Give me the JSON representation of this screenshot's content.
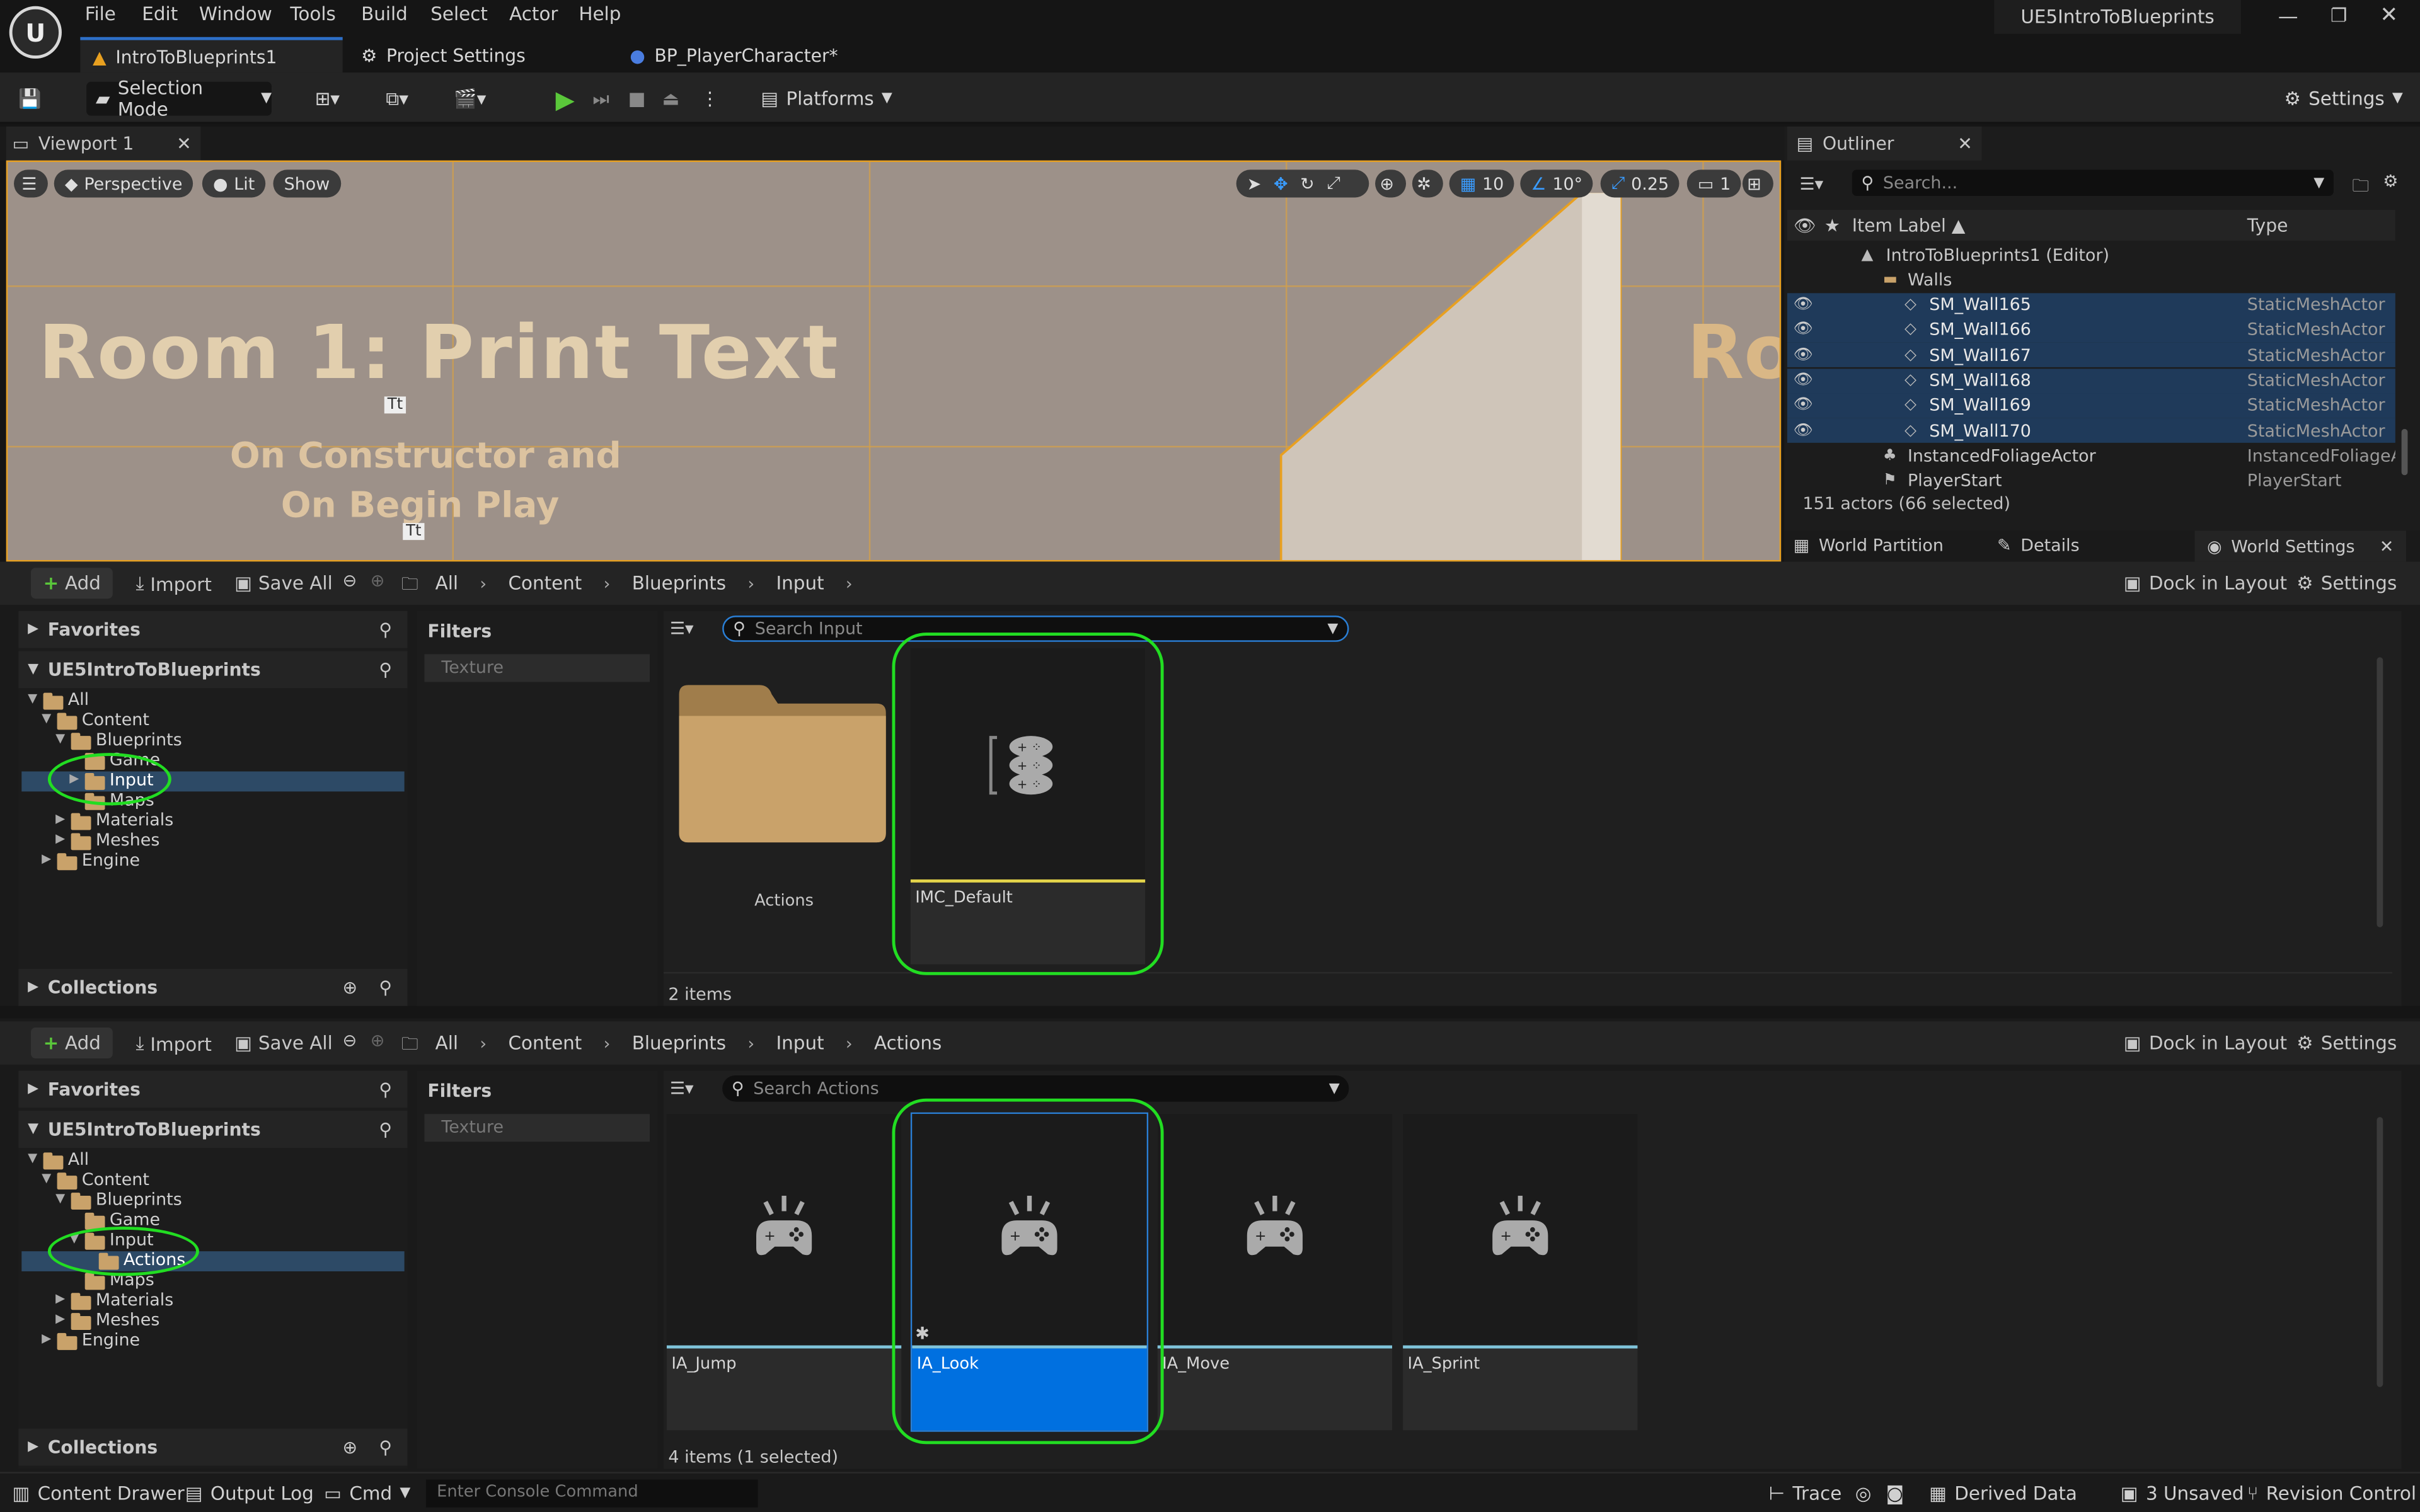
{
  "menu": [
    "File",
    "Edit",
    "Window",
    "Tools",
    "Build",
    "Select",
    "Actor",
    "Help"
  ],
  "project_name": "UE5IntroToBlueprints",
  "tabs": [
    {
      "label": "IntroToBlueprints1",
      "icon": "level-icon"
    },
    {
      "label": "Project Settings",
      "icon": "gear-icon"
    },
    {
      "label": "BP_PlayerCharacter*",
      "icon": "character-icon"
    }
  ],
  "toolbar": {
    "selection_mode": "Selection Mode",
    "platforms": "Platforms",
    "settings": "Settings"
  },
  "viewport": {
    "tab": "Viewport 1",
    "perspective": "Perspective",
    "lit": "Lit",
    "show": "Show",
    "grid_snap": "10",
    "rot_snap": "10°",
    "scale_snap": "0.25",
    "camera_speed": "1",
    "room_title": "Room 1: Print Text",
    "room_sub1": "On Constructor and",
    "room_sub2": "On Begin Play",
    "room_next": "Ro",
    "text_render_glyph": "Tt"
  },
  "outliner": {
    "title": "Outliner",
    "search_placeholder": "Search...",
    "col_label": "Item Label ▲",
    "col_type": "Type",
    "rows": [
      {
        "label": "IntroToBlueprints1 (Editor)",
        "type": "",
        "indent": 2,
        "selected": false,
        "eye": false,
        "kind": "level"
      },
      {
        "label": "Walls",
        "type": "",
        "indent": 3,
        "selected": false,
        "eye": false,
        "kind": "folder"
      },
      {
        "label": "SM_Wall165",
        "type": "StaticMeshActor",
        "indent": 4,
        "selected": true,
        "eye": true,
        "kind": "mesh"
      },
      {
        "label": "SM_Wall166",
        "type": "StaticMeshActor",
        "indent": 4,
        "selected": true,
        "eye": true,
        "kind": "mesh"
      },
      {
        "label": "SM_Wall167",
        "type": "StaticMeshActor",
        "indent": 4,
        "selected": true,
        "eye": true,
        "kind": "mesh"
      },
      {
        "label": "SM_Wall168",
        "type": "StaticMeshActor",
        "indent": 4,
        "selected": true,
        "eye": true,
        "kind": "mesh"
      },
      {
        "label": "SM_Wall169",
        "type": "StaticMeshActor",
        "indent": 4,
        "selected": true,
        "eye": true,
        "kind": "mesh"
      },
      {
        "label": "SM_Wall170",
        "type": "StaticMeshActor",
        "indent": 4,
        "selected": true,
        "eye": true,
        "kind": "mesh"
      },
      {
        "label": "InstancedFoliageActor",
        "type": "InstancedFoliageAc",
        "indent": 3,
        "selected": false,
        "eye": false,
        "kind": "foliage"
      },
      {
        "label": "PlayerStart",
        "type": "PlayerStart",
        "indent": 3,
        "selected": false,
        "eye": false,
        "kind": "start"
      }
    ],
    "status": "151 actors (66 selected)",
    "bottom_tabs": [
      "World Partition",
      "Details",
      "World Settings"
    ]
  },
  "cb1": {
    "add": "Add",
    "import": "Import",
    "save_all": "Save All",
    "breadcrumbs": [
      "All",
      "Content",
      "Blueprints",
      "Input"
    ],
    "dock": "Dock in Layout",
    "settings": "Settings",
    "favorites": "Favorites",
    "project": "UE5IntroToBlueprints",
    "filters": "Filters",
    "filter_chip": "Texture",
    "search_placeholder": "Search Input",
    "collections": "Collections",
    "tree": [
      {
        "label": "All",
        "depth": 0,
        "open": true
      },
      {
        "label": "Content",
        "depth": 1,
        "open": true
      },
      {
        "label": "Blueprints",
        "depth": 2,
        "open": true
      },
      {
        "label": "Game",
        "depth": 3,
        "open": false
      },
      {
        "label": "Input",
        "depth": 3,
        "open": false,
        "selected": true
      },
      {
        "label": "Maps",
        "depth": 3,
        "open": false
      },
      {
        "label": "Materials",
        "depth": 2,
        "open": false
      },
      {
        "label": "Meshes",
        "depth": 2,
        "open": false
      },
      {
        "label": "Engine",
        "depth": 1,
        "open": false
      }
    ],
    "items": [
      {
        "label": "Actions",
        "kind": "folder"
      },
      {
        "label": "IMC_Default",
        "kind": "mapping"
      }
    ],
    "count": "2 items"
  },
  "cb2": {
    "add": "Add",
    "import": "Import",
    "save_all": "Save All",
    "breadcrumbs": [
      "All",
      "Content",
      "Blueprints",
      "Input",
      "Actions"
    ],
    "dock": "Dock in Layout",
    "settings": "Settings",
    "favorites": "Favorites",
    "project": "UE5IntroToBlueprints",
    "filters": "Filters",
    "filter_chip": "Texture",
    "search_placeholder": "Search Actions",
    "collections": "Collections",
    "tree": [
      {
        "label": "All",
        "depth": 0,
        "open": true
      },
      {
        "label": "Content",
        "depth": 1,
        "open": true
      },
      {
        "label": "Blueprints",
        "depth": 2,
        "open": true
      },
      {
        "label": "Game",
        "depth": 3,
        "open": false
      },
      {
        "label": "Input",
        "depth": 3,
        "open": true
      },
      {
        "label": "Actions",
        "depth": 4,
        "open": false,
        "selected": true
      },
      {
        "label": "Maps",
        "depth": 3,
        "open": false
      },
      {
        "label": "Materials",
        "depth": 2,
        "open": false
      },
      {
        "label": "Meshes",
        "depth": 2,
        "open": false
      },
      {
        "label": "Engine",
        "depth": 1,
        "open": false
      }
    ],
    "items": [
      {
        "label": "IA_Jump",
        "selected": false
      },
      {
        "label": "IA_Look",
        "selected": true
      },
      {
        "label": "IA_Move",
        "selected": false
      },
      {
        "label": "IA_Sprint",
        "selected": false
      }
    ],
    "count": "4 items (1 selected)"
  },
  "statusbar": {
    "content_drawer": "Content Drawer",
    "output_log": "Output Log",
    "cmd": "Cmd",
    "console_placeholder": "Enter Console Command",
    "trace": "Trace",
    "derived_data": "Derived Data",
    "unsaved": "3 Unsaved",
    "revision": "Revision Control"
  },
  "colors": {
    "accent_blue": "#0070e0",
    "play_green": "#5ac73a",
    "annotation_green": "#22dd22",
    "folder_tan": "#c9a26a",
    "selection_row": "#1f3a5a"
  }
}
